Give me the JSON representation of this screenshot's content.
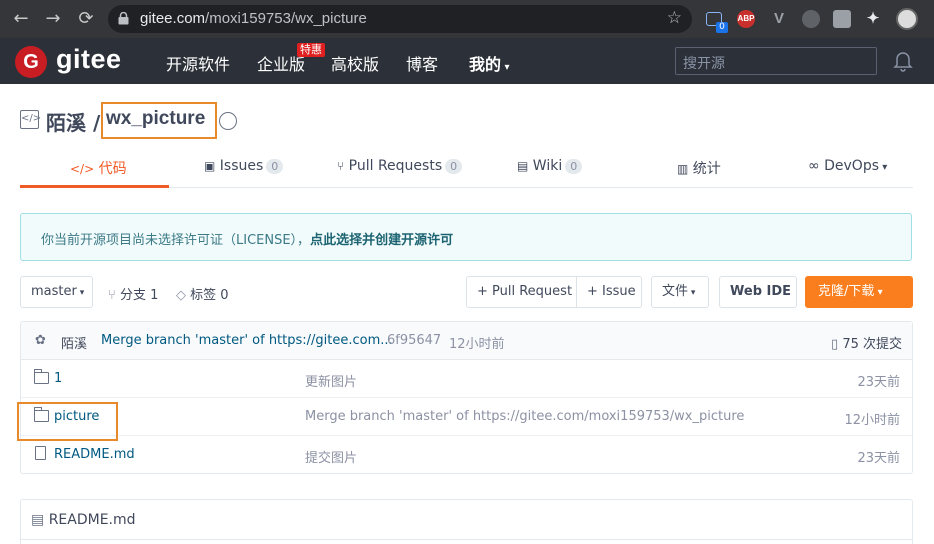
{
  "browser": {
    "url_host": "gitee.com",
    "url_path": "/moxi159753/wx_picture",
    "ext_badge": "0",
    "ext_abp": "ABP",
    "ext_v": "V"
  },
  "header": {
    "logo_letter": "G",
    "logo_text": "gitee",
    "nav": [
      "开源软件",
      "企业版",
      "高校版",
      "博客",
      "我的"
    ],
    "hot_badge": "特惠",
    "search_placeholder": "搜开源"
  },
  "repo": {
    "owner": "陌溪",
    "separator": "/",
    "name": "wx_picture"
  },
  "tabs": [
    {
      "label": "代码",
      "icon": "</>"
    },
    {
      "label": "Issues",
      "count": "0"
    },
    {
      "label": "Pull Requests",
      "count": "0"
    },
    {
      "label": "Wiki",
      "count": "0"
    },
    {
      "label": "统计"
    },
    {
      "label": "DevOps"
    }
  ],
  "notice": {
    "text": "你当前开源项目尚未选择许可证（LICENSE），",
    "link": "点此选择并创建开源许可"
  },
  "toolbar": {
    "branch": "master",
    "branches": "分支 1",
    "tags": "标签 0",
    "pull_request": "+ Pull Request",
    "issue": "+ Issue",
    "files": "文件",
    "web_ide": "Web IDE",
    "clone": "克隆/下载"
  },
  "commit": {
    "author": "陌溪",
    "message": "Merge branch 'master' of https://gitee.com...",
    "hash": "6f95647",
    "time": "12小时前",
    "count": "75 次提交"
  },
  "files": [
    {
      "name": "1",
      "type": "folder",
      "message": "更新图片",
      "time": "23天前"
    },
    {
      "name": "picture",
      "type": "folder",
      "message": "Merge branch 'master' of https://gitee.com/moxi159753/wx_picture",
      "time": "12小时前"
    },
    {
      "name": "README.md",
      "type": "file",
      "message": "提交图片",
      "time": "23天前"
    }
  ],
  "readme": {
    "title": "README.md"
  },
  "colors": {
    "accent": "#f05a26",
    "clone_button": "#fa7e1d",
    "highlight_box": "#e8892b",
    "gitee_red": "#c71d23"
  }
}
